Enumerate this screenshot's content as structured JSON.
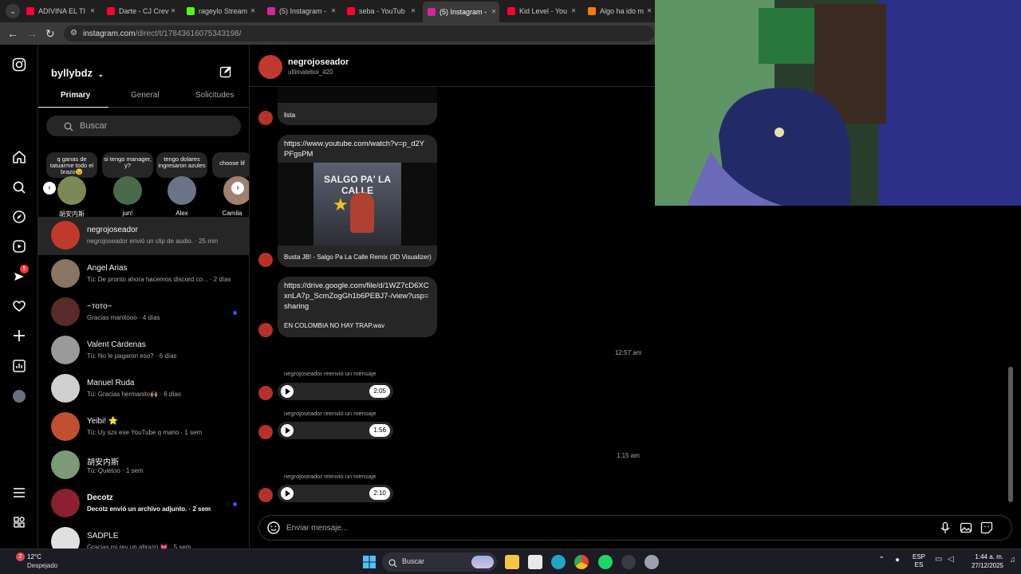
{
  "browser": {
    "tabs": [
      {
        "label": "ADIVINA EL TI",
        "color": "#ff0033",
        "active": false
      },
      {
        "label": "Darte - CJ Crev",
        "color": "#ff0033",
        "active": false
      },
      {
        "label": "rageylo Stream",
        "color": "#53fc18",
        "active": false
      },
      {
        "label": "(5) Instagram -",
        "color": "#d6249f",
        "active": false
      },
      {
        "label": "seba - YouTub",
        "color": "#ff0033",
        "active": false
      },
      {
        "label": "(5) Instagram -",
        "color": "#d6249f",
        "active": true
      },
      {
        "label": "Kid Level - You",
        "color": "#ff0033",
        "active": false
      },
      {
        "label": "Algo ha ido m",
        "color": "#f57c00",
        "active": false
      }
    ],
    "url_host": "instagram.com",
    "url_path": "/direct/t/17843616075343198/"
  },
  "inbox": {
    "username": "byllybdz",
    "tabs": [
      "Primary",
      "General",
      "Solicitudes"
    ],
    "search_placeholder": "Buscar",
    "notes": [
      {
        "text": "q ganas de tatuarme todo el brazo😉",
        "name": "胡安内斯",
        "color": "#7b8a55"
      },
      {
        "text": "si tengo manager, y?",
        "name": "jun!",
        "color": "#4a6b4a"
      },
      {
        "text": "tengo dolares ingresaron azules",
        "name": "Alex",
        "color": "#6a7388"
      },
      {
        "text": "choose lif",
        "name": "Camila",
        "color": "#a08070"
      }
    ],
    "conversations": [
      {
        "name": "negrojoseador",
        "preview": "negrojoseador envió un clip de audio. · 25 min",
        "color": "#c0392b",
        "bold": false,
        "unread": false
      },
      {
        "name": "Angel Arias",
        "preview": "Tú: De pronto ahora hacemos discord co... · 2 días",
        "color": "#8a7560",
        "bold": false,
        "unread": false
      },
      {
        "name": "~тото~",
        "preview": "Gracias manitooo · 4 días",
        "color": "#5a2a2a",
        "bold": false,
        "unread": true
      },
      {
        "name": "Valent Cárdenas",
        "preview": "Tú: No le pagaron eso? · 6 días",
        "color": "#9a9a9a",
        "bold": false,
        "unread": false
      },
      {
        "name": "Manuel Ruda",
        "preview": "Tú: Gracias hermanito🙌🏽 · 6 días",
        "color": "#d0d0d0",
        "bold": false,
        "unread": false
      },
      {
        "name": "Yeibi! ⭐",
        "preview": "Tú: Uy szs ese YouTube q mano · 1 sem",
        "color": "#c05030",
        "bold": false,
        "unread": false
      },
      {
        "name": "胡安内斯",
        "preview": "Tú: Quietoo · 1 sem",
        "color": "#7b9a75",
        "bold": false,
        "unread": false
      },
      {
        "name": "Decotz",
        "preview": "Decotz envió un archivo adjunto. · 2 sem",
        "color": "#8a2030",
        "bold": true,
        "unread": true
      },
      {
        "name": "SADPLE",
        "preview": "Gracias mi rey un abrazo 💓 · 5 sem",
        "color": "#e0e0e0",
        "bold": false,
        "unread": false
      }
    ]
  },
  "thread": {
    "name": "negrojoseador",
    "handle": "ultimateboi_420",
    "msg1_caption": "lista",
    "link1": "https://www.youtube.com/watch?v=p_d2YPFgsPM",
    "video_title": "Busta JB! - Salgo Pa La Calle Remix (3D Visualizer)",
    "thumb_text": "SALGO PA' LA CALLE",
    "link2": "https://drive.google.com/file/d/1WZ7cD6XCxnLA7p_ScmZogGh1b6PEBJ7-/view?usp=sharing",
    "file_name": "EN COLOMBIA NO HAY TRAP.wav",
    "time1": "12:57 am",
    "time2": "1:15 am",
    "forward_label": "negrojoseador reenvió un mensaje",
    "audio_durations": [
      "2:05",
      "1:56",
      "2:10"
    ],
    "composer_placeholder": "Enviar mensaje..."
  },
  "rail": {
    "notification_badge": "5"
  },
  "taskbar": {
    "weather_temp": "12°C",
    "weather_desc": "Despejado",
    "weather_badge": "2",
    "search_label": "Buscar",
    "lang1": "ESP",
    "lang2": "ES",
    "time": "1:44 a. m.",
    "date": "27/12/2025"
  }
}
